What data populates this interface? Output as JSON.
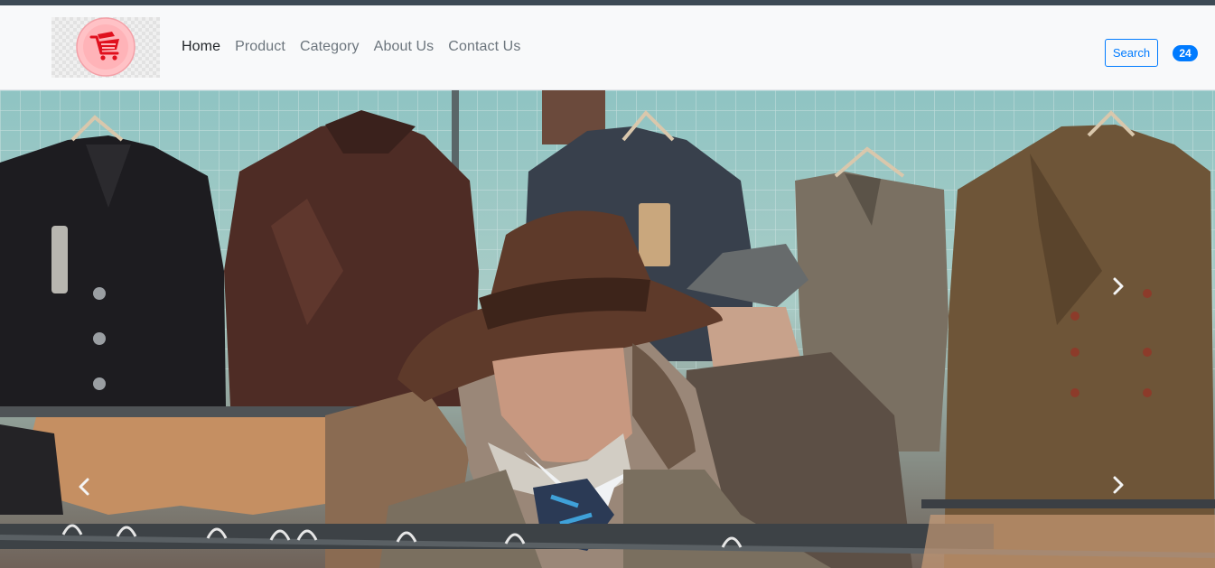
{
  "nav": {
    "logo_icon": "shopping-cart-icon",
    "links": [
      {
        "label": "Home",
        "active": true
      },
      {
        "label": "Product",
        "active": false
      },
      {
        "label": "Category",
        "active": false
      },
      {
        "label": "About Us",
        "active": false
      },
      {
        "label": "Contact Us",
        "active": false
      }
    ],
    "search_label": "Search",
    "cart_count": "24"
  },
  "carousel": {
    "next_icon": "chevron-right-icon",
    "prev_icon": "chevron-left-icon"
  },
  "colors": {
    "primary": "#007bff",
    "navbar_bg": "#f8f9fa",
    "topbar": "#3d4a55",
    "link": "#6c757d",
    "link_active": "#212529"
  }
}
